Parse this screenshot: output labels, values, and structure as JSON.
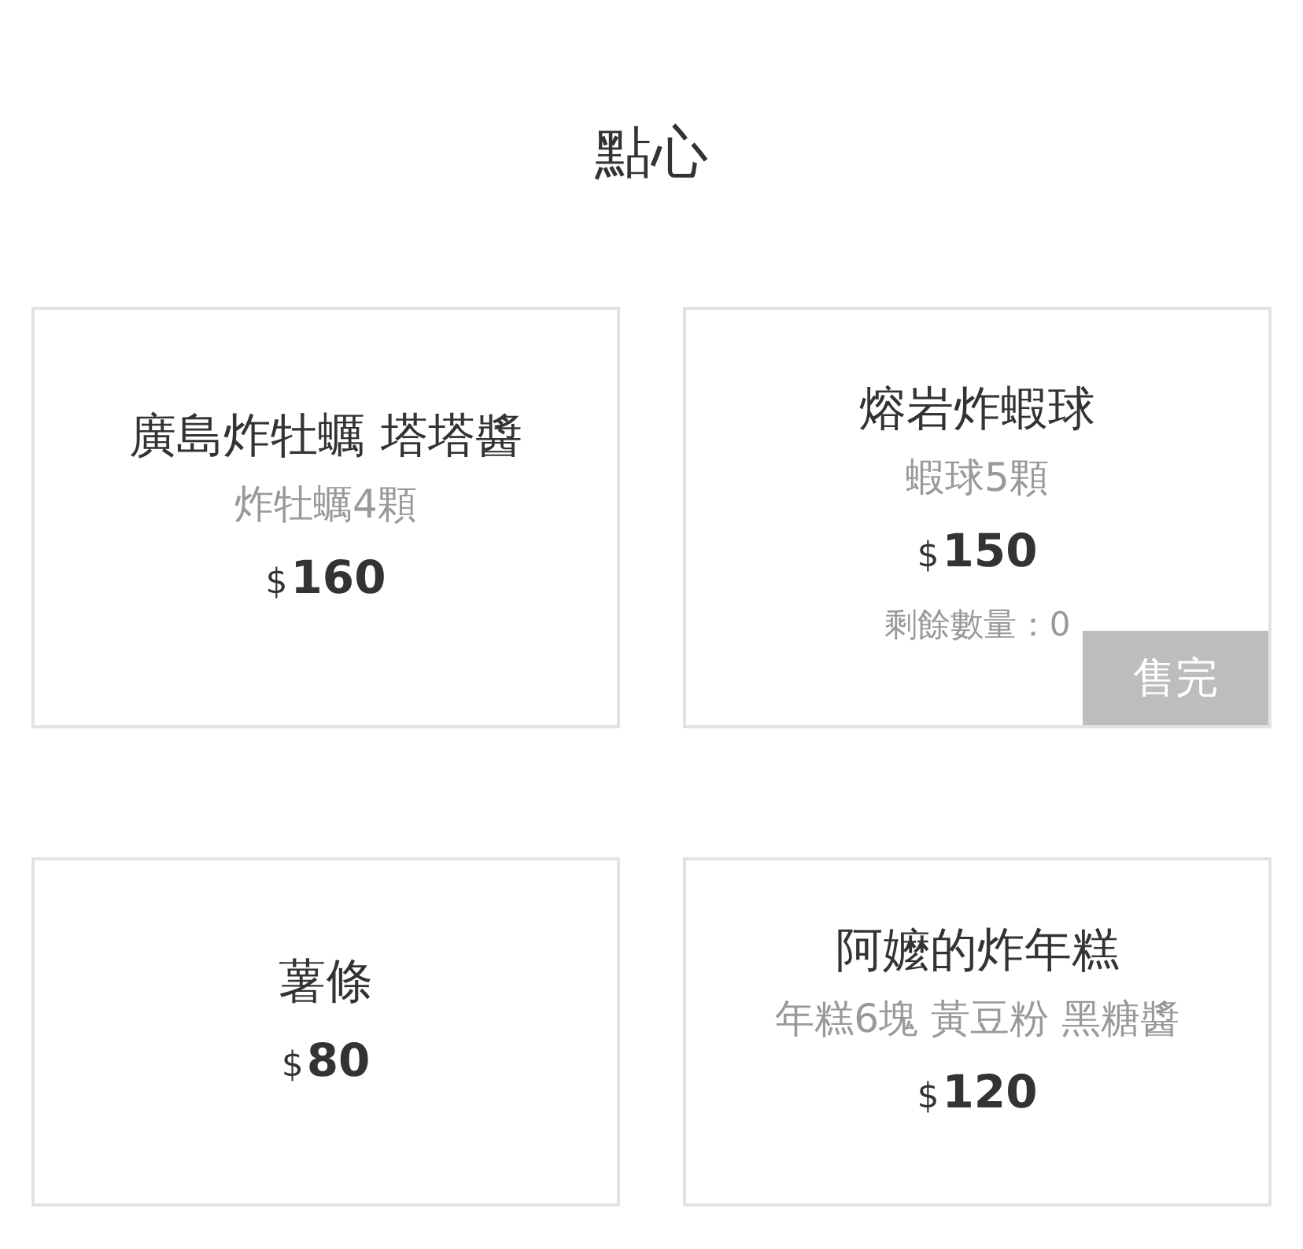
{
  "section": {
    "title": "點心"
  },
  "items": [
    {
      "name": "廣島炸牡蠣 塔塔醬",
      "description": "炸牡蠣4顆",
      "currency": "$",
      "amount": "160",
      "sold_out": false
    },
    {
      "name": "熔岩炸蝦球",
      "description": "蝦球5顆",
      "currency": "$",
      "amount": "150",
      "stock": "剩餘數量：0",
      "sold_out": true,
      "sold_out_label": "售完"
    },
    {
      "name": "薯條",
      "currency": "$",
      "amount": "80",
      "sold_out": false
    },
    {
      "name": "阿嬤的炸年糕",
      "description": "年糕6塊 黃豆粉 黑糖醬",
      "currency": "$",
      "amount": "120",
      "sold_out": false
    }
  ]
}
